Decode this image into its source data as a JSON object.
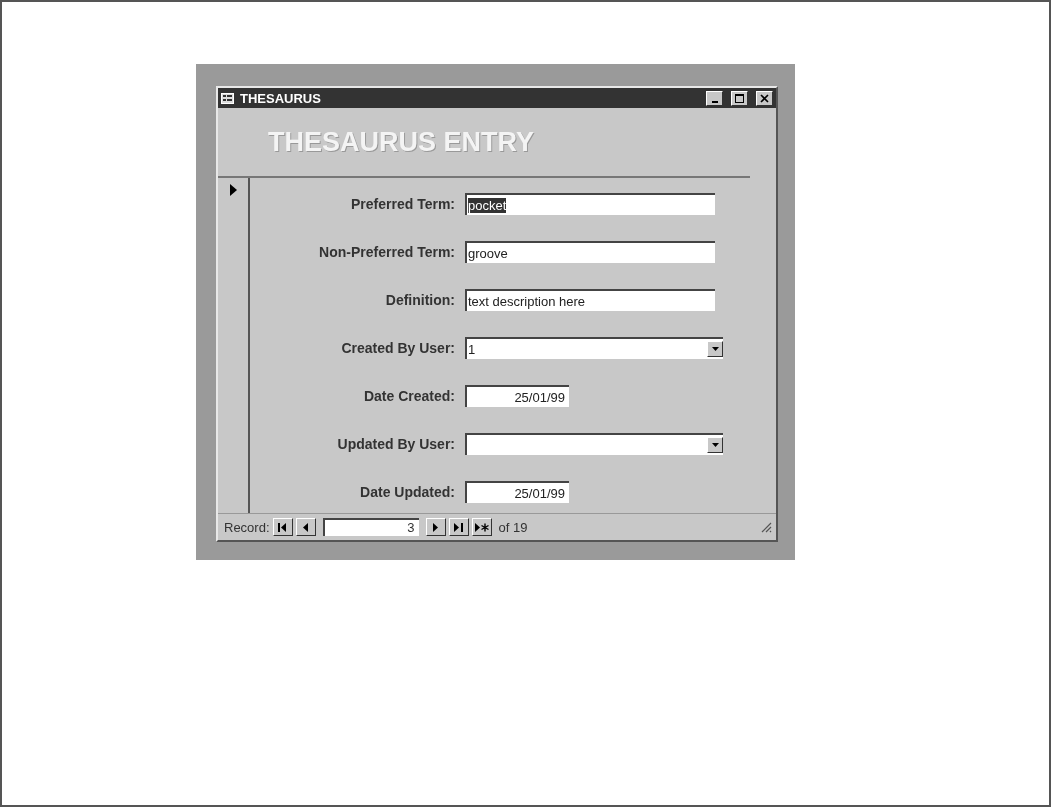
{
  "window": {
    "title": "THESAURUS"
  },
  "form": {
    "heading": "THESAURUS ENTRY",
    "fields": [
      {
        "label": "Preferred Term:",
        "value": "pocket",
        "kind": "text",
        "highlighted": true
      },
      {
        "label": "Non-Preferred Term:",
        "value": "groove",
        "kind": "text",
        "highlighted": false
      },
      {
        "label": "Definition:",
        "value": "text description here",
        "kind": "text",
        "highlighted": false
      },
      {
        "label": "Created By User:",
        "value": "1",
        "kind": "combo",
        "highlighted": false
      },
      {
        "label": "Date Created:",
        "value": "25/01/99",
        "kind": "date",
        "highlighted": false
      },
      {
        "label": "Updated By User:",
        "kind": "combo"
      },
      {
        "label": "Date Updated:",
        "value": "25/01/99",
        "kind": "date",
        "highlighted": false
      }
    ]
  },
  "navigation": {
    "label": "Record:",
    "current": "3",
    "total": "of 19"
  }
}
